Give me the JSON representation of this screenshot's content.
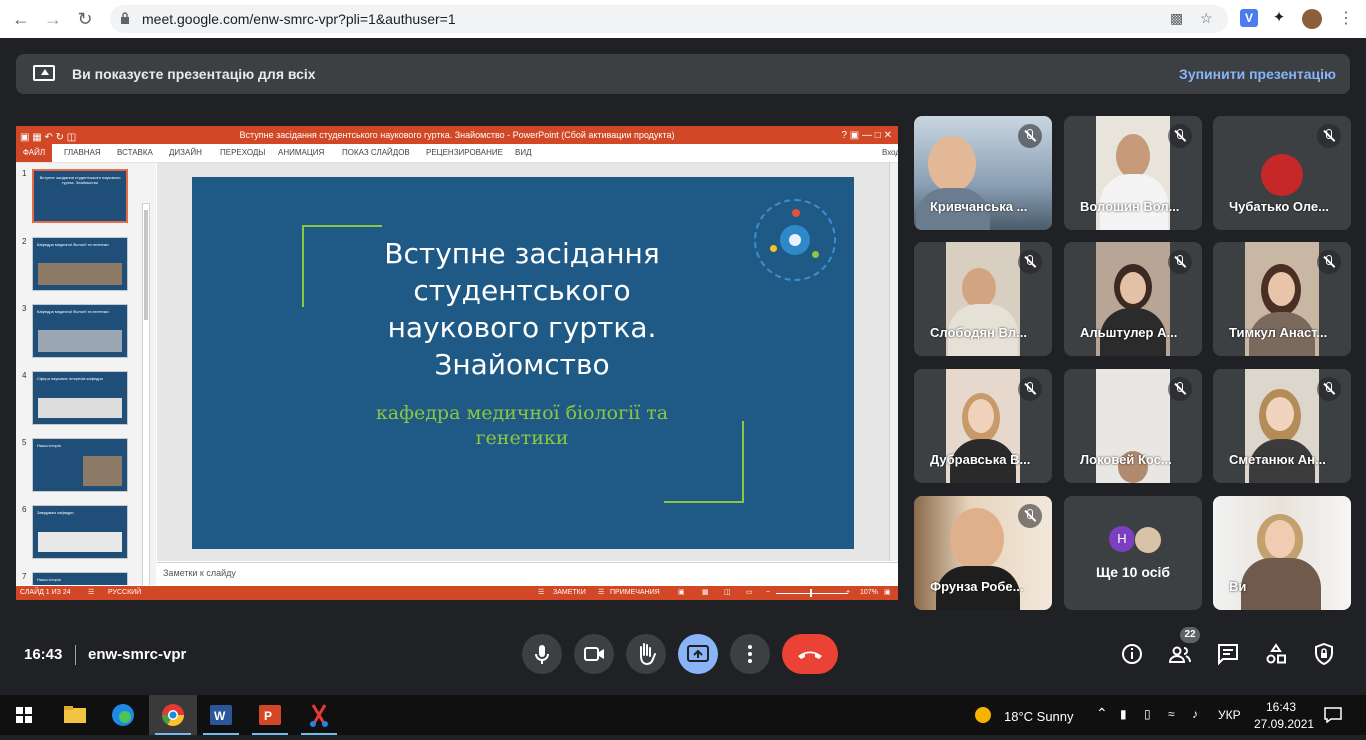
{
  "browser": {
    "url": "meet.google.com/enw-smrc-vpr?pli=1&authuser=1",
    "extension_label": "V"
  },
  "banner": {
    "message": "Ви показуєте презентацію для всіх",
    "stop_label": "Зупинити презентацію"
  },
  "powerpoint": {
    "window_title": "Вступне засідання студентського наукового гуртка. Знайомство - PowerPoint (Сбой активации продукта)",
    "ribbon_tabs": [
      "ФАЙЛ",
      "ГЛАВНАЯ",
      "ВСТАВКА",
      "ДИЗАЙН",
      "ПЕРЕХОДЫ",
      "АНИМАЦИЯ",
      "ПОКАЗ СЛАЙДОВ",
      "РЕЦЕНЗИРОВАНИЕ",
      "ВИД"
    ],
    "sign_in": "Вход",
    "thumbnails": [
      {
        "num": "1",
        "title": "Вступне засідання студентського наукового гуртка. Знайомство"
      },
      {
        "num": "2",
        "title": "Кафедра медичної біології та генетики"
      },
      {
        "num": "3",
        "title": "Кафедра медичної біології та генетики"
      },
      {
        "num": "4",
        "title": "Сфера наукових інтересів кафедри"
      },
      {
        "num": "5",
        "title": "Наша історія"
      },
      {
        "num": "6",
        "title": "Завідувачі кафедри"
      },
      {
        "num": "7",
        "title": "Наша історія"
      }
    ],
    "slide": {
      "title": "Вступне засідання студентського наукового гуртка. Знайомство",
      "subtitle": "кафедра медичної біології та генетики"
    },
    "notes_placeholder": "Заметки к слайду",
    "status": {
      "slide_info": "СЛАЙД 1 ИЗ 24",
      "language": "РУССКИЙ",
      "notes": "ЗАМЕТКИ",
      "comments": "ПРИМЕЧАНИЯ",
      "zoom": "107%",
      "zoom_level_percent": 107
    }
  },
  "participants": [
    {
      "name": "Кривчанська ...",
      "muted": true
    },
    {
      "name": "Волошин Вол...",
      "muted": true
    },
    {
      "name": "Чубатько Оле...",
      "muted": true
    },
    {
      "name": "Слободян Вл...",
      "muted": true
    },
    {
      "name": "Альштулер А...",
      "muted": true
    },
    {
      "name": "Тимкул Анаст...",
      "muted": true
    },
    {
      "name": "Дубравська В...",
      "muted": true
    },
    {
      "name": "Локовей Кос...",
      "muted": true
    },
    {
      "name": "Сметанюк Ан...",
      "muted": true
    },
    {
      "name": "Фрунза Робе...",
      "muted": true
    },
    {
      "name": "Ви",
      "muted": false
    }
  ],
  "more_tile": {
    "initial": "Н",
    "label": "Ще 10 осіб"
  },
  "meeting": {
    "time": "16:43",
    "code": "enw-smrc-vpr",
    "people_count": "22"
  },
  "colors": {
    "accent": "#8ab4f8",
    "hangup": "#ea4335",
    "ppt_brand": "#d24726",
    "slide_bg": "#1f5a86",
    "slide_accent": "#8dc63f"
  },
  "taskbar": {
    "weather": "18°C  Sunny",
    "language": "УКР",
    "time": "16:43",
    "date": "27.09.2021"
  }
}
